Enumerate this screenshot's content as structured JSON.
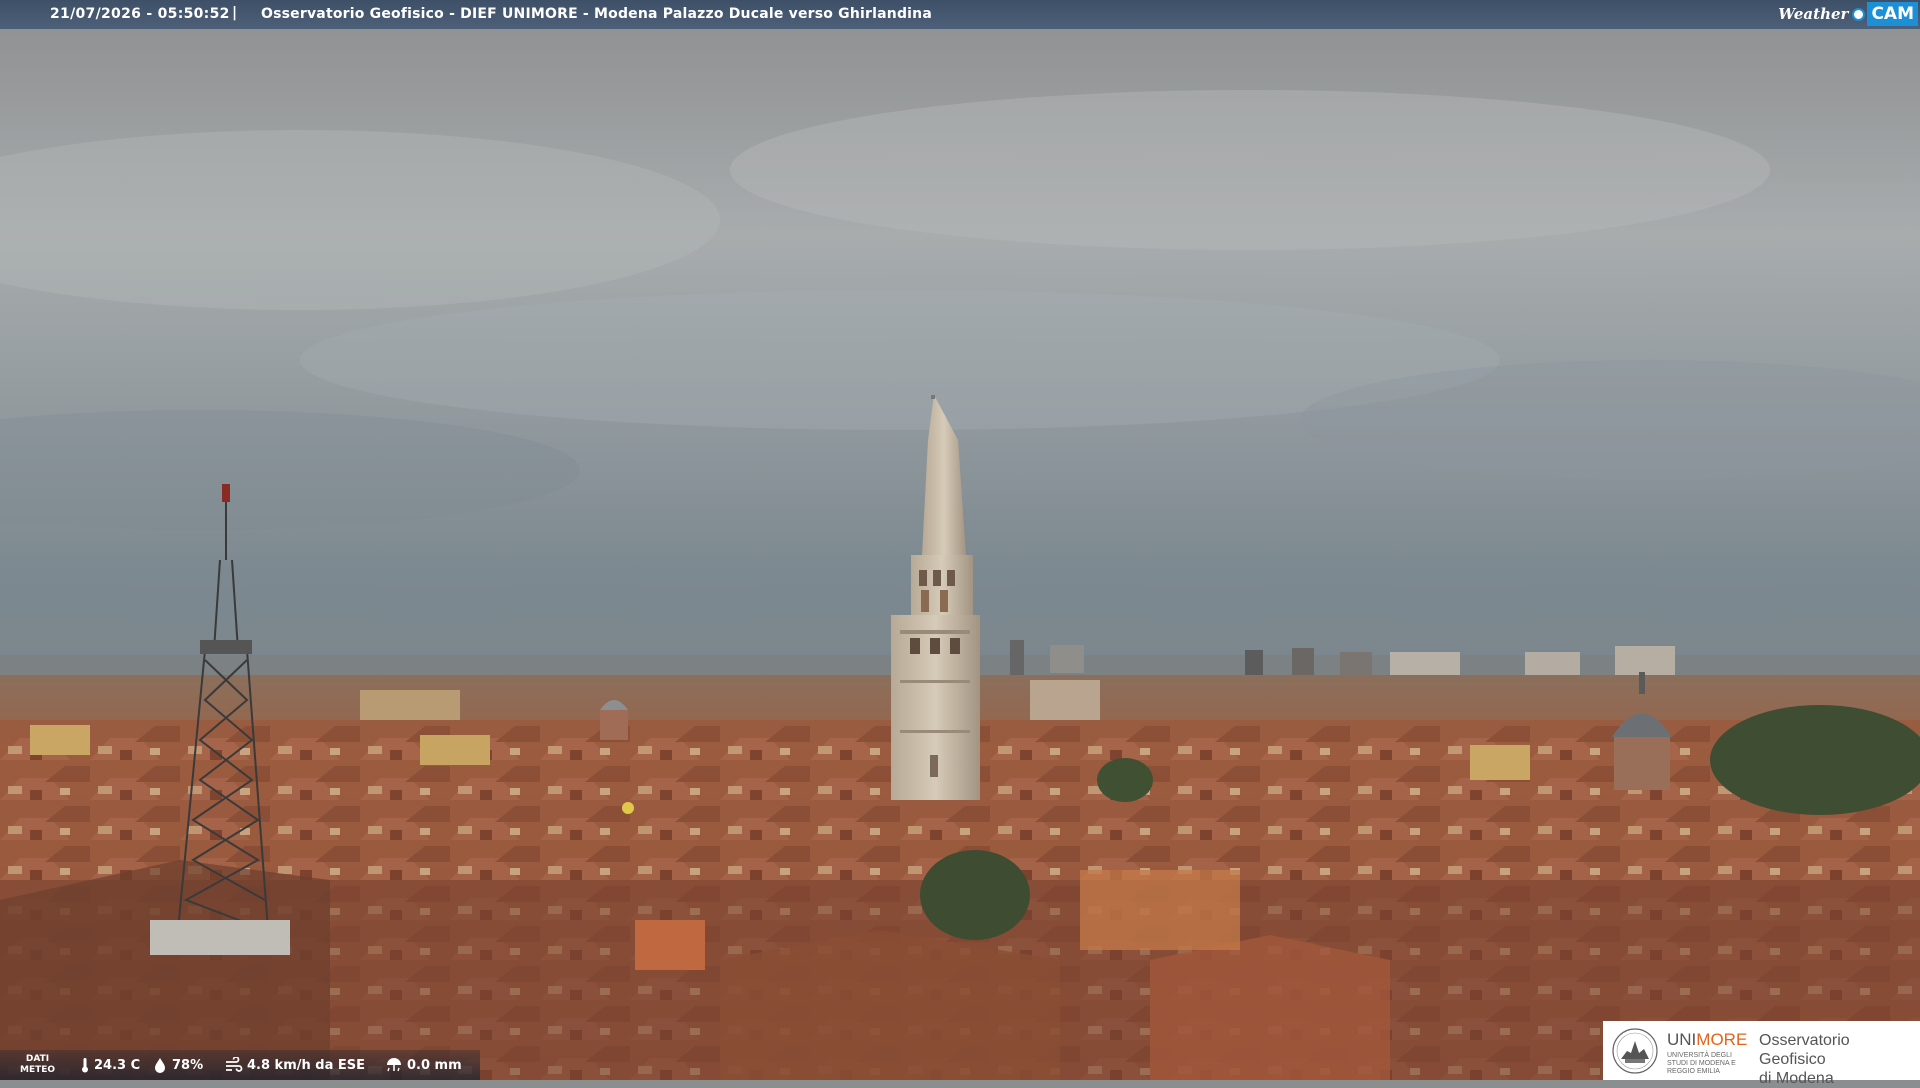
{
  "header": {
    "timestamp": "21/07/2026 - 05:50:52",
    "separator": "|",
    "title": "Osservatorio Geofisico - DIEF UNIMORE - Modena Palazzo Ducale verso Ghirlandina",
    "brand_weather": "Weather",
    "brand_cam": "CAM"
  },
  "weather": {
    "label_line1": "DATI",
    "label_line2": "METEO",
    "temperature": "24.3 C",
    "humidity": "78%",
    "wind": "4.8 km/h da ESE",
    "rain": "0.0 mm"
  },
  "logo": {
    "uni_prefix": "UNI",
    "uni_suffix": "MORE",
    "uni_sub": "UNIVERSITÀ DEGLI STUDI DI MODENA E REGGIO EMILIA",
    "observatory_line1": "Osservatorio Geofisico",
    "observatory_line2": "di Modena"
  },
  "colors": {
    "top_bar": "#46586f",
    "brand_blue": "#1d8fd6",
    "unimore_orange": "#e5631a",
    "roof_terracotta": "#a0573a"
  },
  "icons": {
    "temperature": "thermometer-icon",
    "humidity": "droplet-icon",
    "wind": "wind-icon",
    "rain": "rain-icon",
    "logo": "unimore-seal-icon"
  }
}
